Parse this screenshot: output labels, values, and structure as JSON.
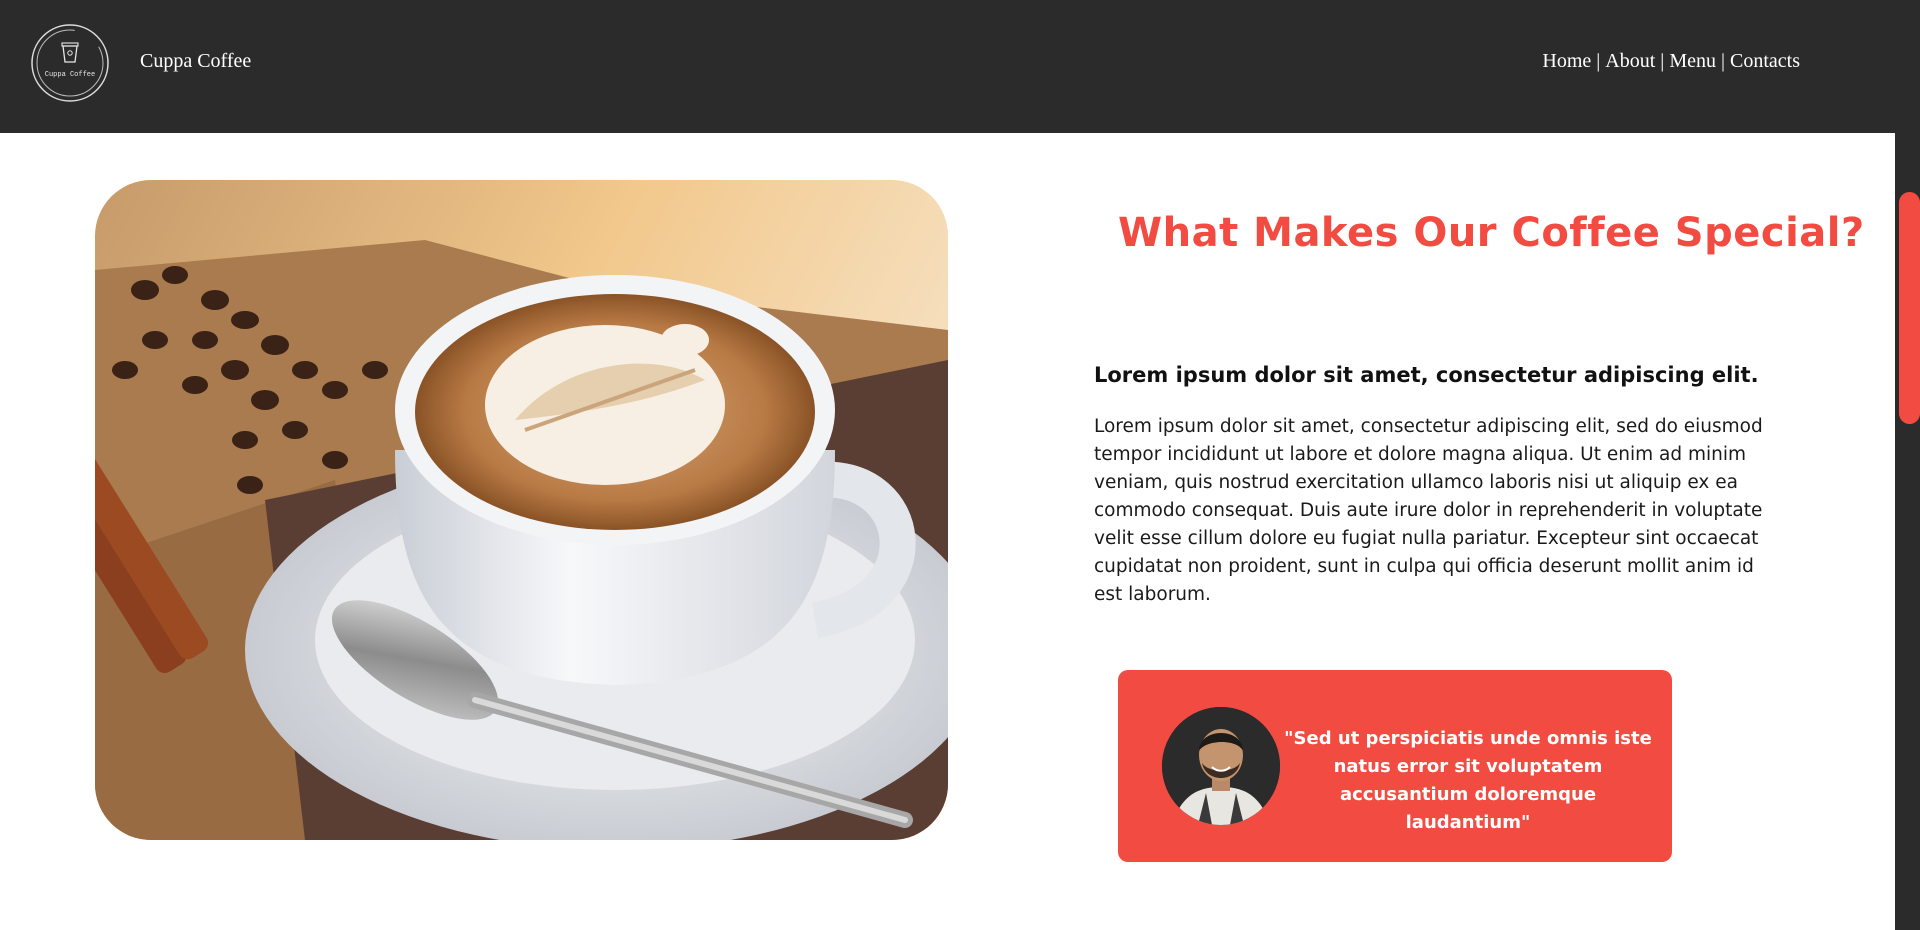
{
  "header": {
    "logo_text": "Cuppa Coffee",
    "brand": "Cuppa Coffee",
    "nav": {
      "home": "Home",
      "about": "About",
      "menu": "Menu",
      "contacts": "Contacts",
      "separator": "|"
    }
  },
  "main": {
    "title": "What Makes Our Coffee Special?",
    "subtitle": "Lorem ipsum dolor sit amet, consectetur adipiscing elit.",
    "body": "Lorem ipsum dolor sit amet, consectetur adipiscing elit, sed do eiusmod tempor incididunt ut labore et dolore magna aliqua. Ut enim ad minim veniam, quis nostrud exercitation ullamco laboris nisi ut aliquip ex ea commodo consequat. Duis aute irure dolor in reprehenderit in voluptate velit esse cillum dolore eu fugiat nulla pariatur. Excepteur sint occaecat cupidatat non proident, sunt in culpa qui officia deserunt mollit anim id est laborum.",
    "testimonial_quote": "\"Sed ut perspiciatis unde omnis iste natus error sit voluptatem accusantium doloremque laudantium\""
  },
  "colors": {
    "header_bg": "#2b2b2b",
    "accent": "#f24c42",
    "text": "#1a1a1a",
    "background": "#ffffff"
  },
  "icons": {
    "logo": "coffee-cup-logo-icon",
    "hero": "latte-cup-image",
    "avatar": "barista-avatar-image"
  }
}
